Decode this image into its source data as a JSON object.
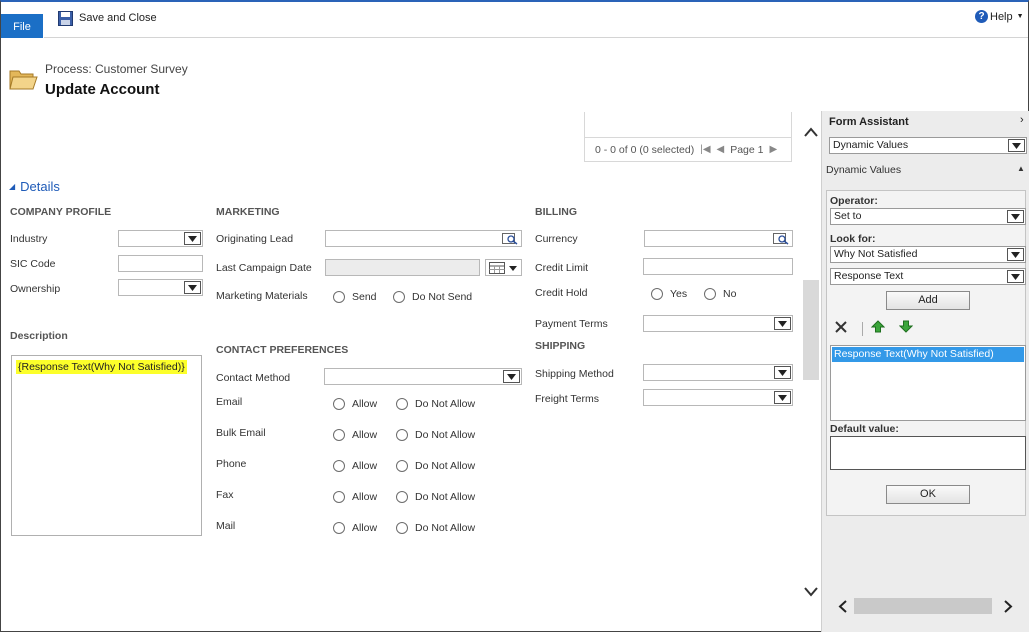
{
  "toolbar": {
    "file_label": "File",
    "save_close_label": "Save and Close",
    "help_label": "Help"
  },
  "header": {
    "subtitle": "Process: Customer Survey",
    "title": "Update Account"
  },
  "grid": {
    "records_text": "0 - 0 of 0 (0 selected)",
    "page_label": "Page 1"
  },
  "details": {
    "section_label": "Details",
    "company_profile": {
      "heading": "COMPANY PROFILE",
      "industry_label": "Industry",
      "sic_label": "SIC Code",
      "ownership_label": "Ownership"
    },
    "description": {
      "heading": "Description",
      "token": "{Response Text(Why Not Satisfied)}"
    },
    "marketing": {
      "heading": "MARKETING",
      "originating_lead_label": "Originating Lead",
      "last_campaign_label": "Last Campaign Date",
      "materials_label": "Marketing Materials",
      "send_label": "Send",
      "do_not_send_label": "Do Not Send"
    },
    "contact_preferences": {
      "heading": "CONTACT PREFERENCES",
      "method_label": "Contact Method",
      "allow_label": "Allow",
      "do_not_allow_label": "Do Not Allow",
      "rows": [
        "Email",
        "Bulk Email",
        "Phone",
        "Fax",
        "Mail"
      ]
    },
    "billing": {
      "heading": "BILLING",
      "currency_label": "Currency",
      "credit_limit_label": "Credit Limit",
      "credit_hold_label": "Credit Hold",
      "yes_label": "Yes",
      "no_label": "No",
      "payment_terms_label": "Payment Terms"
    },
    "shipping": {
      "heading": "SHIPPING",
      "method_label": "Shipping Method",
      "freight_label": "Freight Terms"
    }
  },
  "form_assistant": {
    "title": "Form Assistant",
    "mode_select": "Dynamic Values",
    "section_label": "Dynamic Values",
    "operator_label": "Operator:",
    "operator_value": "Set to",
    "look_for_label": "Look for:",
    "look_for_value": "Why Not Satisfied",
    "field_value": "Response Text",
    "add_label": "Add",
    "list_items": [
      "Response Text(Why Not Satisfied)"
    ],
    "default_value_label": "Default value:",
    "ok_label": "OK"
  }
}
